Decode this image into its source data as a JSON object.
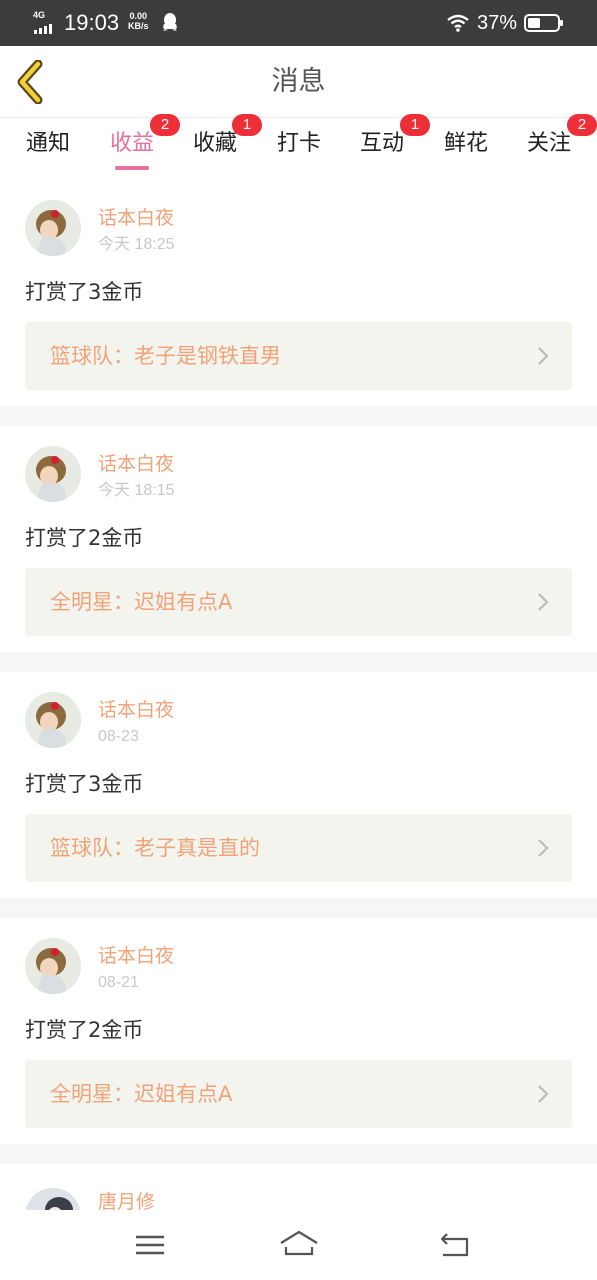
{
  "status_bar": {
    "network": "4G",
    "time": "19:03",
    "speed_value": "0.00",
    "speed_unit": "KB/s",
    "battery": "37%",
    "icons": [
      "signal-icon",
      "qq-icon",
      "wifi-icon",
      "battery-icon"
    ]
  },
  "header": {
    "title": "消息",
    "back_icon": "chevron-left-icon"
  },
  "tabs": [
    {
      "label": "通知",
      "badge": ""
    },
    {
      "label": "收益",
      "badge": "2",
      "active": true
    },
    {
      "label": "收藏",
      "badge": "1"
    },
    {
      "label": "打卡",
      "badge": ""
    },
    {
      "label": "互动",
      "badge": "1"
    },
    {
      "label": "鲜花",
      "badge": ""
    },
    {
      "label": "关注",
      "badge": "2"
    }
  ],
  "messages": [
    {
      "user": "话本白夜",
      "time": "今天 18:25",
      "action": "打赏了3金币",
      "link": "篮球队：老子是钢铁直男"
    },
    {
      "user": "话本白夜",
      "time": "今天 18:15",
      "action": "打赏了2金币",
      "link": "全明星：迟姐有点A"
    },
    {
      "user": "话本白夜",
      "time": "08-23",
      "action": "打赏了3金币",
      "link": "篮球队：老子真是直的"
    },
    {
      "user": "话本白夜",
      "time": "08-21",
      "action": "打赏了2金币",
      "link": "全明星：迟姐有点A"
    },
    {
      "user": "唐月修"
    }
  ],
  "colors": {
    "accent_pink": "#e8709d",
    "name_orange": "#f0a378",
    "badge_red": "#ee2f37",
    "status_bar_bg": "#3c3c3c",
    "link_bg": "#f4f4ee"
  },
  "nav": {
    "icons": [
      "menu-icon",
      "home-icon",
      "back-nav-icon"
    ]
  }
}
